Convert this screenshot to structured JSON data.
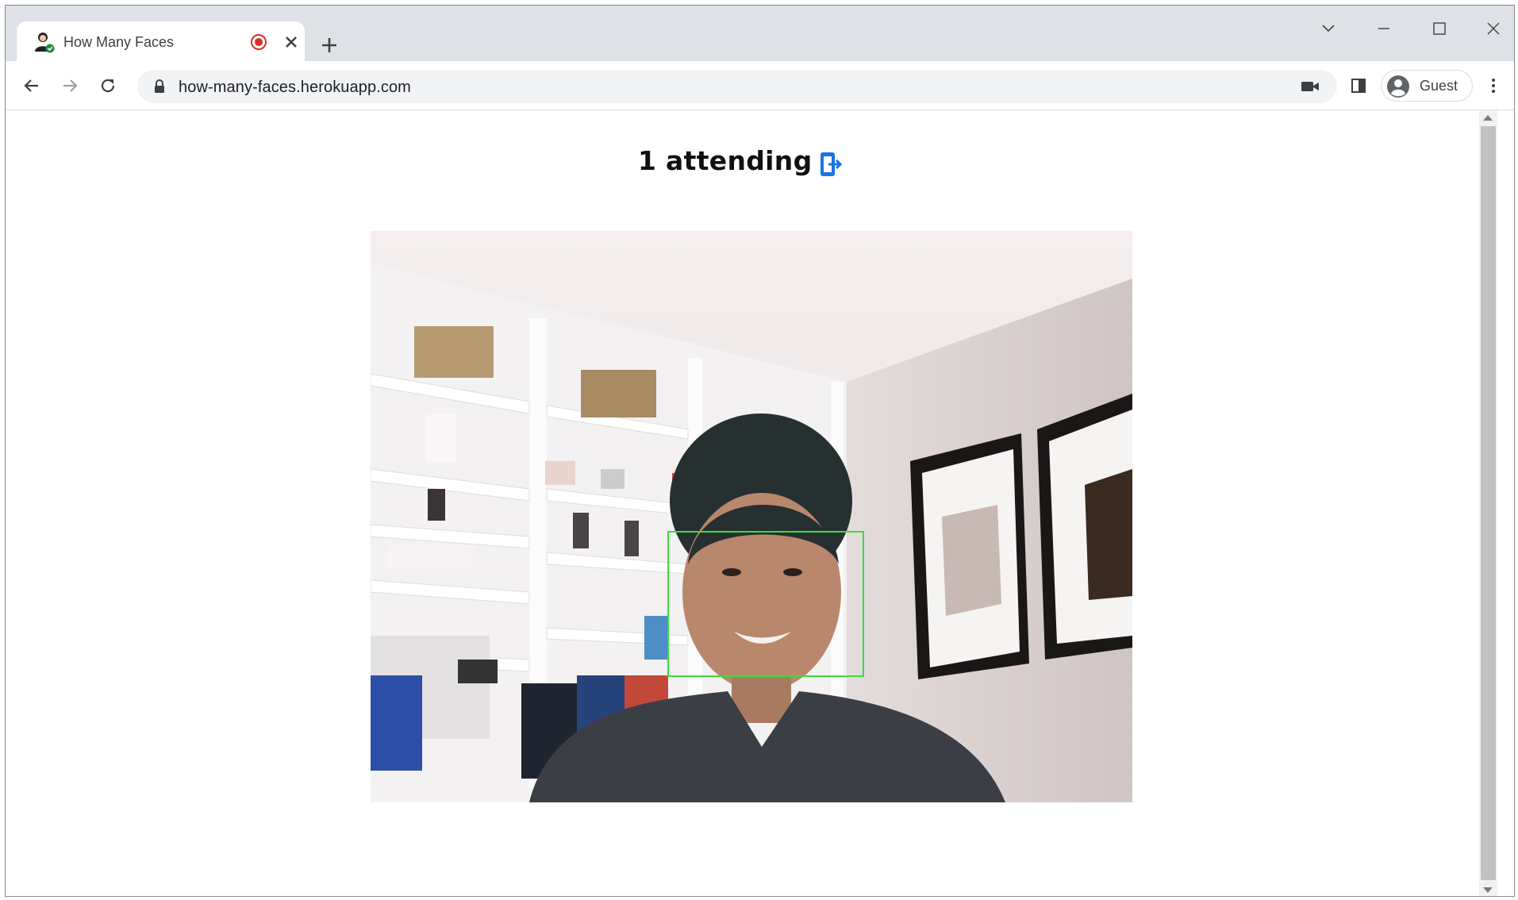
{
  "browser": {
    "tab": {
      "title": "How Many Faces",
      "favicon": "person-check-icon",
      "recording": true
    },
    "url": "how-many-faces.herokuapp.com",
    "profile_label": "Guest"
  },
  "page": {
    "heading": "1 attending",
    "attendee_count": 1,
    "leave_icon": "exit-icon",
    "accent_color": "#1a73e8",
    "face_box_color": "#3cdc3c",
    "video_description_icon": "webcam-feed"
  }
}
